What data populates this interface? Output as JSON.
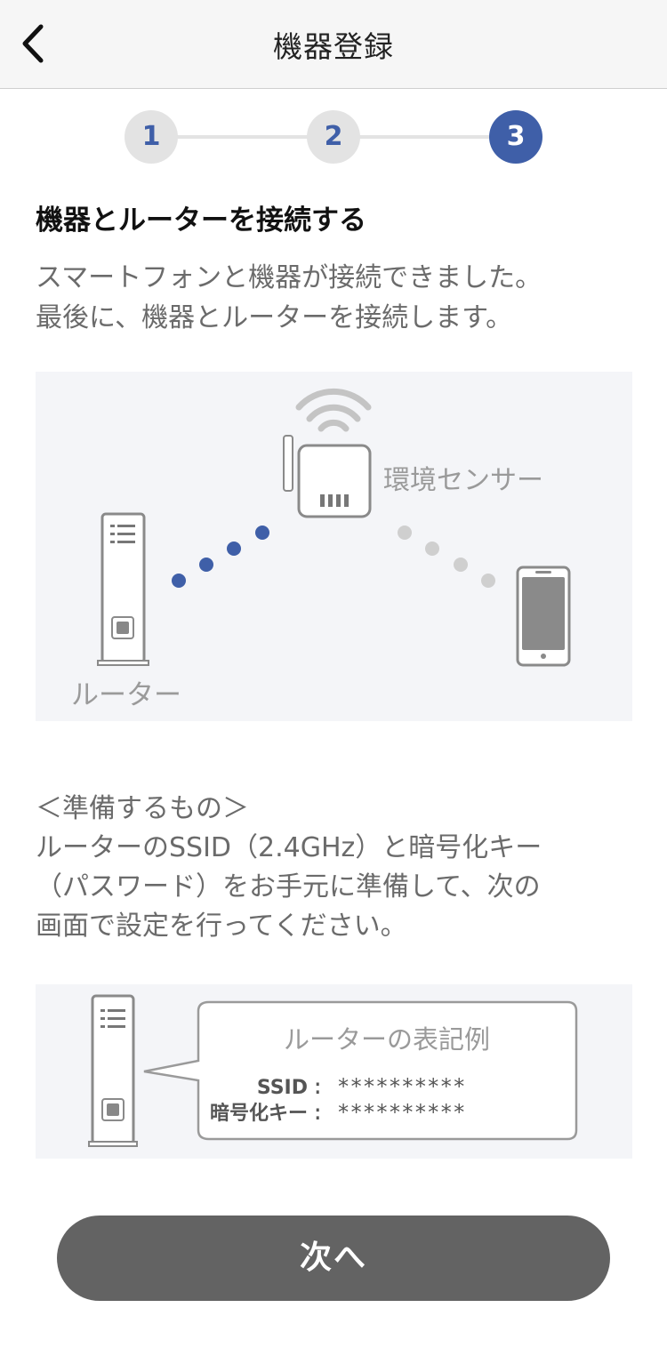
{
  "header": {
    "title": "機器登録",
    "back_icon": "chevron-left-icon"
  },
  "stepper": {
    "steps": [
      "1",
      "2",
      "3"
    ],
    "current": 3,
    "active_color": "#3f5fa8",
    "inactive_color": "#e3e3e3"
  },
  "section_title": "機器とルーターを接続する",
  "description": [
    "スマートフォンと機器が接続できました。",
    "最後に、機器とルーターを接続します。"
  ],
  "illustration1": {
    "device_label": "環境センサー",
    "router_label": "ルーター"
  },
  "prep": {
    "heading": "＜準備するもの＞",
    "lines": [
      "ルーターのSSID（2.4GHz）と暗号化キー",
      "（パスワード）をお手元に準備して、次の",
      "画面で設定を行ってください。"
    ]
  },
  "illustration2": {
    "bubble_title": "ルーターの表記例",
    "ssid_label": "SSID",
    "ssid_value": ": **********",
    "key_label": "暗号化キー",
    "key_value": ": **********"
  },
  "next_button": {
    "label": "次へ",
    "color": "#636363"
  }
}
